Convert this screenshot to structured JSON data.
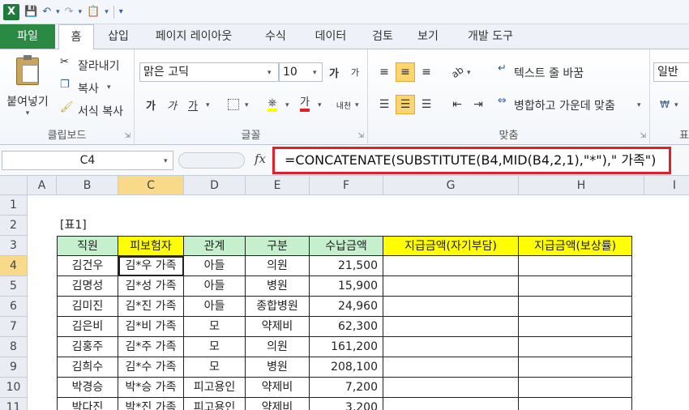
{
  "qat": {
    "excel_icon": "X",
    "save_icon": "save-icon",
    "undo_icon": "undo-icon",
    "redo_icon": "redo-icon"
  },
  "tabs": [
    "파일",
    "홈",
    "삽입",
    "페이지 레이아웃",
    "수식",
    "데이터",
    "검토",
    "보기",
    "개발 도구"
  ],
  "ribbon": {
    "clipboard": {
      "paste": "붙여넣기",
      "cut": "잘라내기",
      "copy": "복사",
      "format_painter": "서식 복사",
      "label": "클립보드"
    },
    "font": {
      "name": "맑은 고딕",
      "size": "10",
      "label": "글꼴",
      "bold": "가",
      "italic": "가",
      "underline": "가",
      "grow": "가",
      "shrink": "가",
      "phonetic": "내천",
      "font_color": "가"
    },
    "alignment": {
      "wrap": "텍스트 줄 바꿈",
      "merge": "병합하고 가운데 맞춤",
      "label": "맞춤"
    },
    "number": {
      "format": "일반",
      "label": "표"
    }
  },
  "formula_bar": {
    "name_box": "C4",
    "fx": "fx",
    "formula": "=CONCATENATE(SUBSTITUTE(B4,MID(B4,2,1),\"*\"),\" 가족\")"
  },
  "columns": [
    "A",
    "B",
    "C",
    "D",
    "E",
    "F",
    "G",
    "H",
    "I"
  ],
  "rows": [
    "1",
    "2",
    "3",
    "4",
    "5",
    "6",
    "7",
    "8",
    "9",
    "10",
    "11"
  ],
  "sheet": {
    "table_title": "[표1]",
    "headers": [
      "직원",
      "피보험자",
      "관계",
      "구분",
      "수납금액",
      "지급금액(자기부담)",
      "지급금액(보상률)"
    ],
    "data": [
      [
        "김건우",
        "김*우 가족",
        "아들",
        "의원",
        "21,500"
      ],
      [
        "김명성",
        "김*성 가족",
        "아들",
        "병원",
        "15,900"
      ],
      [
        "김미진",
        "김*진 가족",
        "아들",
        "종합병원",
        "24,960"
      ],
      [
        "김은비",
        "김*비 가족",
        "모",
        "약제비",
        "62,300"
      ],
      [
        "김홍주",
        "김*주 가족",
        "모",
        "의원",
        "161,200"
      ],
      [
        "김희수",
        "김*수 가족",
        "모",
        "병원",
        "208,100"
      ],
      [
        "박경승",
        "박*승 가족",
        "피고용인",
        "약제비",
        "7,200"
      ],
      [
        "박다진",
        "박*진 가족",
        "피고용인",
        "약제비",
        "3,200"
      ]
    ]
  },
  "colors": {
    "header_green": "#c6efce",
    "header_yellow": "#ffff00",
    "highlight_border": "#e0202a",
    "file_tab": "#2a8a44"
  }
}
